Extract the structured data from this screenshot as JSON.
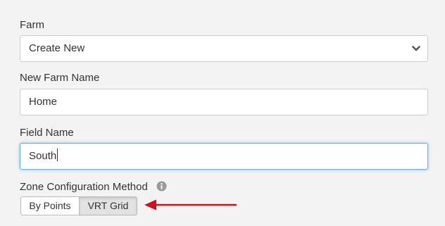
{
  "farm": {
    "label": "Farm",
    "selected": "Create New"
  },
  "new_farm_name": {
    "label": "New Farm Name",
    "value": "Home"
  },
  "field_name": {
    "label": "Field Name",
    "value": "South"
  },
  "zone_method": {
    "label": "Zone Configuration Method",
    "options": [
      "By Points",
      "VRT Grid"
    ],
    "selected": "VRT Grid"
  },
  "colors": {
    "background": "#f3f3f3",
    "focus_border": "#66afe9",
    "annotation_arrow": "#d0101a",
    "active_segment": "#e2e2e2"
  },
  "icons": {
    "select_chevron": "chevron-down-icon",
    "info": "info-icon",
    "annotation": "red-arrow-icon"
  }
}
